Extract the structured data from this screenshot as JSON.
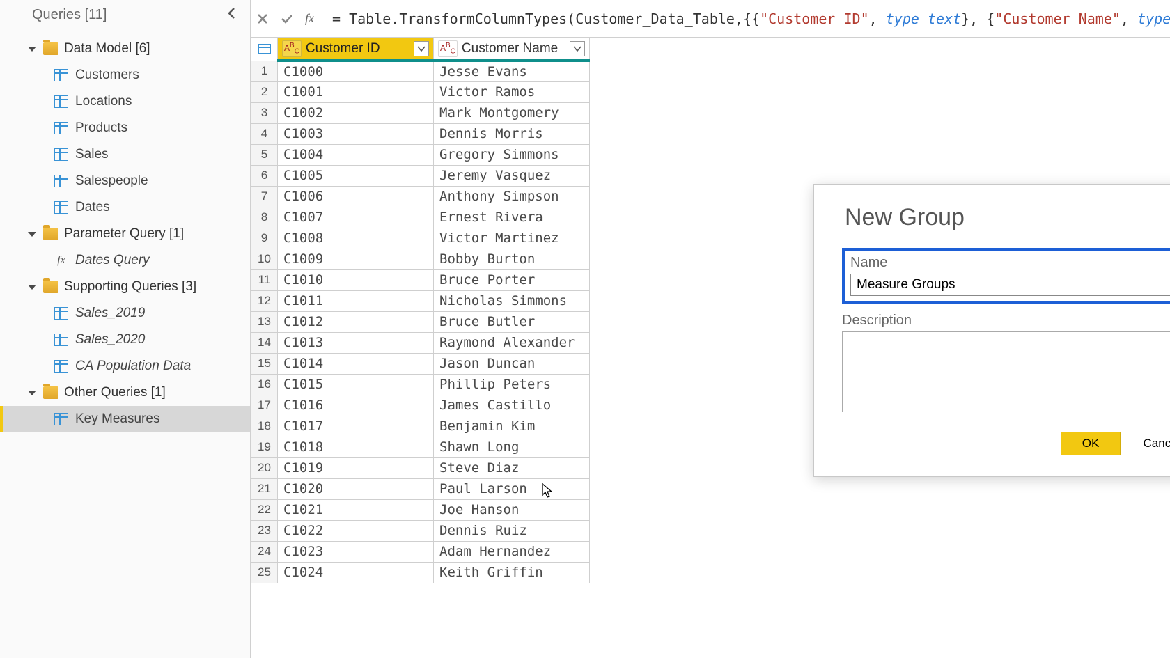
{
  "sidebar": {
    "title": "Queries [11]",
    "folders": [
      {
        "label": "Data Model [6]",
        "items": [
          {
            "label": "Customers",
            "icon": "table",
            "style": "normal"
          },
          {
            "label": "Locations",
            "icon": "table",
            "style": "normal"
          },
          {
            "label": "Products",
            "icon": "table",
            "style": "normal"
          },
          {
            "label": "Sales",
            "icon": "table",
            "style": "normal"
          },
          {
            "label": "Salespeople",
            "icon": "table",
            "style": "normal"
          },
          {
            "label": "Dates",
            "icon": "table",
            "style": "normal"
          }
        ]
      },
      {
        "label": "Parameter Query [1]",
        "items": [
          {
            "label": "Dates Query",
            "icon": "fx",
            "style": "italic"
          }
        ]
      },
      {
        "label": "Supporting Queries [3]",
        "items": [
          {
            "label": "Sales_2019",
            "icon": "table",
            "style": "italic"
          },
          {
            "label": "Sales_2020",
            "icon": "table",
            "style": "italic"
          },
          {
            "label": "CA Population Data",
            "icon": "table",
            "style": "italic"
          }
        ]
      },
      {
        "label": "Other Queries [1]",
        "items": [
          {
            "label": "Key Measures",
            "icon": "table",
            "style": "normal",
            "selected": true
          }
        ]
      }
    ]
  },
  "formula": {
    "prefix": "= Table.TransformColumnTypes(Customer_Data_Table,{{",
    "str1": "\"Customer ID\"",
    "mid1": ", ",
    "kw1": "type text",
    "mid2": "}, {",
    "str2": "\"Customer Name\"",
    "mid3": ", ",
    "kw2": "type"
  },
  "grid": {
    "columns": [
      {
        "label": "Customer ID",
        "selected": true
      },
      {
        "label": "Customer Name",
        "selected": false
      }
    ],
    "rows": [
      {
        "n": 1,
        "id": "C1000",
        "name": "Jesse Evans"
      },
      {
        "n": 2,
        "id": "C1001",
        "name": "Victor Ramos"
      },
      {
        "n": 3,
        "id": "C1002",
        "name": "Mark Montgomery"
      },
      {
        "n": 4,
        "id": "C1003",
        "name": "Dennis Morris"
      },
      {
        "n": 5,
        "id": "C1004",
        "name": "Gregory Simmons"
      },
      {
        "n": 6,
        "id": "C1005",
        "name": "Jeremy Vasquez"
      },
      {
        "n": 7,
        "id": "C1006",
        "name": "Anthony Simpson"
      },
      {
        "n": 8,
        "id": "C1007",
        "name": "Ernest Rivera"
      },
      {
        "n": 9,
        "id": "C1008",
        "name": "Victor Martinez"
      },
      {
        "n": 10,
        "id": "C1009",
        "name": "Bobby Burton"
      },
      {
        "n": 11,
        "id": "C1010",
        "name": "Bruce Porter"
      },
      {
        "n": 12,
        "id": "C1011",
        "name": "Nicholas Simmons"
      },
      {
        "n": 13,
        "id": "C1012",
        "name": "Bruce Butler"
      },
      {
        "n": 14,
        "id": "C1013",
        "name": "Raymond Alexander"
      },
      {
        "n": 15,
        "id": "C1014",
        "name": "Jason Duncan"
      },
      {
        "n": 16,
        "id": "C1015",
        "name": "Phillip Peters"
      },
      {
        "n": 17,
        "id": "C1016",
        "name": "James Castillo"
      },
      {
        "n": 18,
        "id": "C1017",
        "name": "Benjamin Kim"
      },
      {
        "n": 19,
        "id": "C1018",
        "name": "Shawn Long"
      },
      {
        "n": 20,
        "id": "C1019",
        "name": "Steve Diaz"
      },
      {
        "n": 21,
        "id": "C1020",
        "name": "Paul Larson"
      },
      {
        "n": 22,
        "id": "C1021",
        "name": "Joe Hanson"
      },
      {
        "n": 23,
        "id": "C1022",
        "name": "Dennis Ruiz"
      },
      {
        "n": 24,
        "id": "C1023",
        "name": "Adam Hernandez"
      },
      {
        "n": 25,
        "id": "C1024",
        "name": "Keith Griffin"
      }
    ]
  },
  "dialog": {
    "title": "New Group",
    "name_label": "Name",
    "name_value": "Measure Groups",
    "desc_label": "Description",
    "desc_value": "",
    "ok": "OK",
    "cancel": "Cancel"
  }
}
